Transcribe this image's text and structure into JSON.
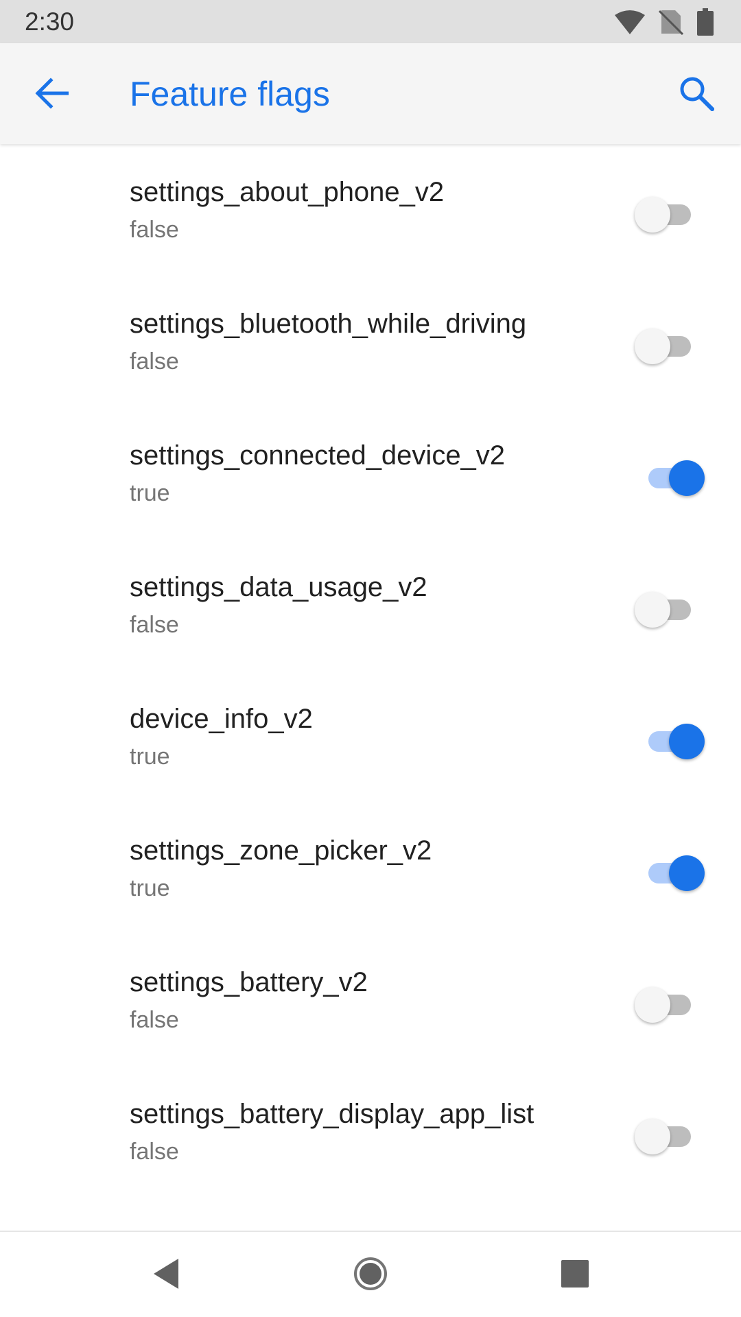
{
  "status_bar": {
    "time": "2:30",
    "icons": [
      "wifi-icon",
      "no-sim-icon",
      "battery-icon"
    ]
  },
  "app_bar": {
    "title": "Feature flags",
    "back_icon": "arrow-back-icon",
    "search_icon": "search-icon",
    "accent_color": "#1a73e8"
  },
  "flags": [
    {
      "name": "settings_about_phone_v2",
      "value": "false",
      "enabled": false
    },
    {
      "name": "settings_bluetooth_while_driving",
      "value": "false",
      "enabled": false
    },
    {
      "name": "settings_connected_device_v2",
      "value": "true",
      "enabled": true
    },
    {
      "name": "settings_data_usage_v2",
      "value": "false",
      "enabled": false
    },
    {
      "name": "device_info_v2",
      "value": "true",
      "enabled": true
    },
    {
      "name": "settings_zone_picker_v2",
      "value": "true",
      "enabled": true
    },
    {
      "name": "settings_battery_v2",
      "value": "false",
      "enabled": false
    },
    {
      "name": "settings_battery_display_app_list",
      "value": "false",
      "enabled": false
    }
  ],
  "nav_bar": {
    "buttons": [
      "back-triangle-icon",
      "home-circle-icon",
      "recents-square-icon"
    ]
  }
}
